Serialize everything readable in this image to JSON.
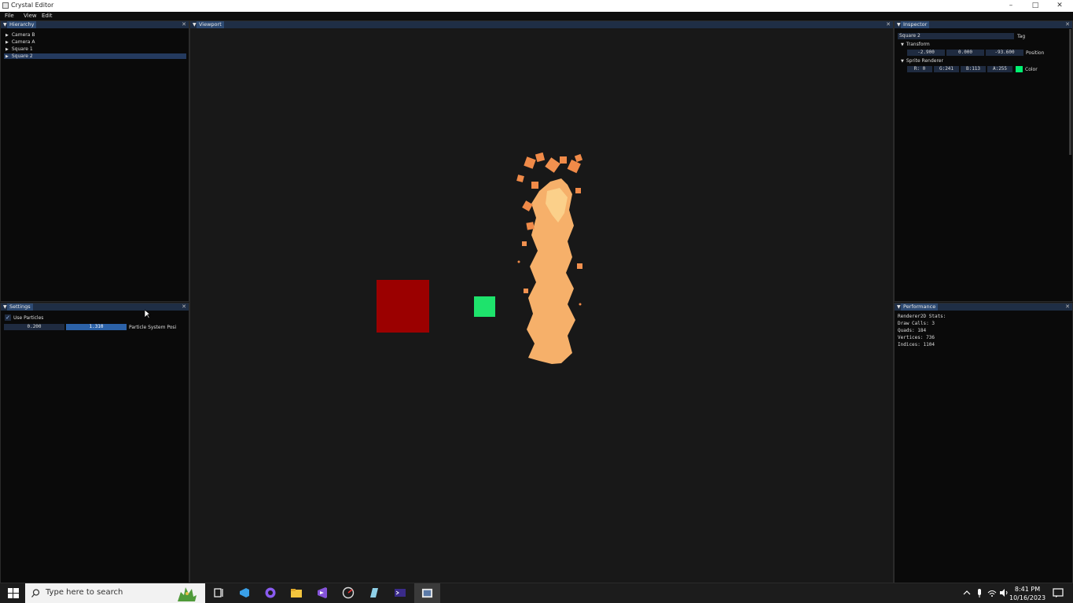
{
  "window": {
    "title": "Crystal Editor",
    "controls": [
      "–",
      "□",
      "✕"
    ]
  },
  "menu": [
    "File",
    "View",
    "Edit"
  ],
  "hierarchy": {
    "title": "Hierarchy",
    "items": [
      "Camera B",
      "Camera A",
      "Square 1",
      "Square 2"
    ],
    "selected": "Square 2"
  },
  "settings": {
    "title": "Settings",
    "checkbox_label": "Use Particles",
    "checked": true,
    "fields": [
      "0.200",
      "1.310"
    ],
    "field_label": "Particle System Posi"
  },
  "viewport": {
    "title": "Viewport"
  },
  "inspector": {
    "title": "Inspector",
    "name": "Square 2",
    "tag_label": "Tag",
    "transform": {
      "header": "Transform",
      "position": [
        "-2.900",
        "0.000",
        "-93.600"
      ],
      "label": "Position"
    },
    "sprite": {
      "header": "Sprite Renderer",
      "color": [
        "R:  0",
        "G:241",
        "B:113",
        "A:255"
      ],
      "label": "Color",
      "swatch": "#00f171"
    }
  },
  "performance": {
    "title": "Performance",
    "lines": [
      "Renderer2D Stats:",
      "Draw Calls: 3",
      "Quads: 184",
      "Vertices: 736",
      "Indices: 1104"
    ]
  },
  "taskbar": {
    "search_placeholder": "Type here to search",
    "time": "8:41 PM",
    "date": "10/16/2023"
  },
  "colors": {
    "red_square": "#9b0000",
    "green_square": "#1ee36c",
    "particles": "#f6ad66"
  }
}
